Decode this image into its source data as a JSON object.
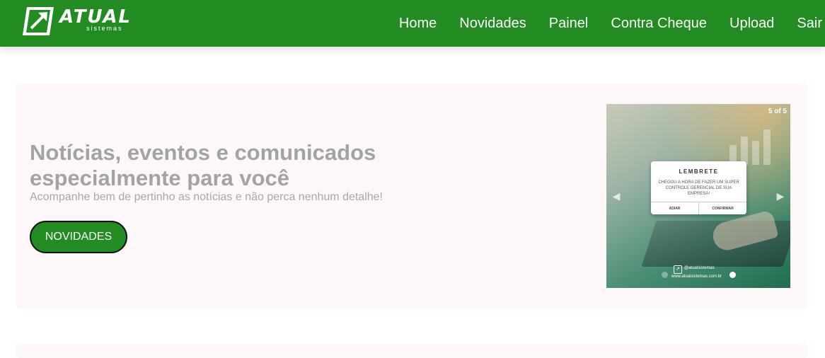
{
  "brand": {
    "name": "ATUAL",
    "tagline": "sistemas",
    "primary_color": "#228b22"
  },
  "nav": {
    "items": [
      {
        "label": "Home"
      },
      {
        "label": "Novidades"
      },
      {
        "label": "Painel"
      },
      {
        "label": "Contra Cheque"
      },
      {
        "label": "Upload"
      },
      {
        "label": "Sair"
      }
    ]
  },
  "hero": {
    "title": "Notícias, eventos e comunicados especialmente para você",
    "subtitle": "Acompanhe bem de pertinho as notícias e não perca nenhum detalhe!",
    "button_label": "NOVIDADES"
  },
  "carousel": {
    "counter": "5 of 5",
    "current_slide": 5,
    "total_slides": 5,
    "prev_icon": "chevron-left-icon",
    "next_icon": "chevron-right-icon",
    "slide": {
      "popup_title": "LEMBRETE",
      "popup_text": "CHEGOU A HORA DE FAZER UM SUPER CONTROLE GERENCIAL DE SUA EMPRESA!",
      "popup_cancel": "ADIAR",
      "popup_confirm": "CONFIRMAR",
      "social_handle": "@atualsistemas",
      "website": "www.atualsistemas.com.br"
    }
  }
}
